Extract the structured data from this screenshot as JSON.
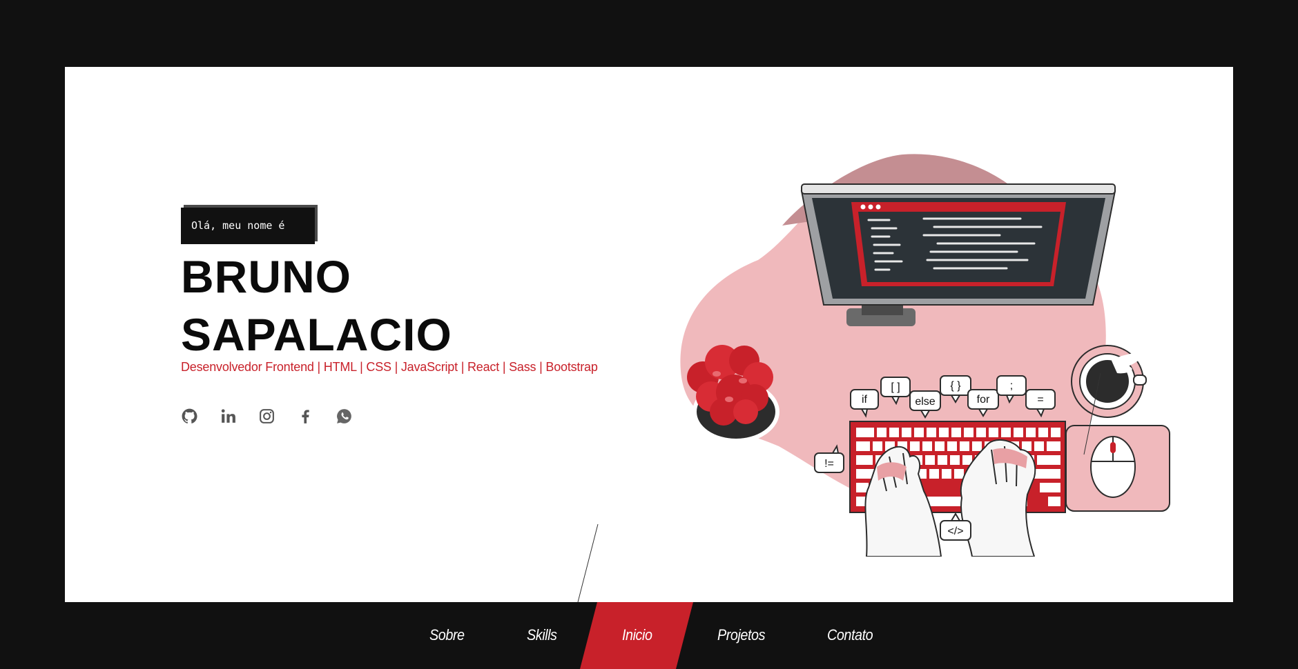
{
  "hero": {
    "greeting": "Olá, meu nome é",
    "name_line1": "BRUNO",
    "name_line2": "SAPALACIO",
    "tagline": "Desenvolvedor Frontend | HTML | CSS | JavaScript | React | Sass | Bootstrap"
  },
  "socials": [
    {
      "icon": "github-icon"
    },
    {
      "icon": "linkedin-icon"
    },
    {
      "icon": "instagram-icon"
    },
    {
      "icon": "facebook-icon"
    },
    {
      "icon": "whatsapp-icon"
    }
  ],
  "illustration": {
    "bubbles": [
      "if",
      "[ ]",
      "else",
      "{ }",
      "for",
      ";",
      "=",
      "!=",
      "</>"
    ]
  },
  "nav": {
    "items": [
      "Sobre",
      "Skills",
      "Inicio",
      "Projetos",
      "Contato"
    ],
    "active": "Inicio"
  },
  "colors": {
    "accent": "#c8212a",
    "background": "#111111",
    "card": "#ffffff",
    "blob": "#f0b9bc"
  }
}
